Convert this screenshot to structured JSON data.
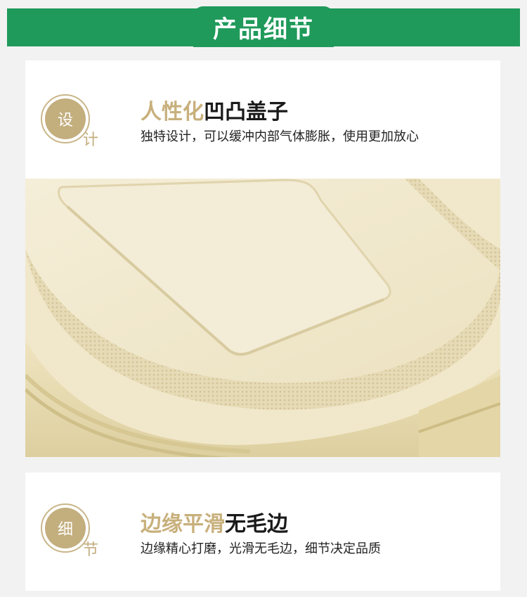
{
  "header": {
    "title": "产品细节"
  },
  "sections": [
    {
      "badge_main": "设",
      "badge_sub": "计",
      "title_highlight": "人性化",
      "title_rest": "凹凸盖子",
      "description": "独特设计，可以缓冲内部气体膨胀，使用更加放心"
    },
    {
      "badge_main": "细",
      "badge_sub": "节",
      "title_highlight": "边缘平滑",
      "title_rest": "无毛边",
      "description": "边缘精心打磨，光滑无毛边，细节决定品质"
    }
  ],
  "colors": {
    "brand_green": "#1f9a5a",
    "accent_gold": "#c3ae7e",
    "product_cream": "#efe6c6"
  }
}
